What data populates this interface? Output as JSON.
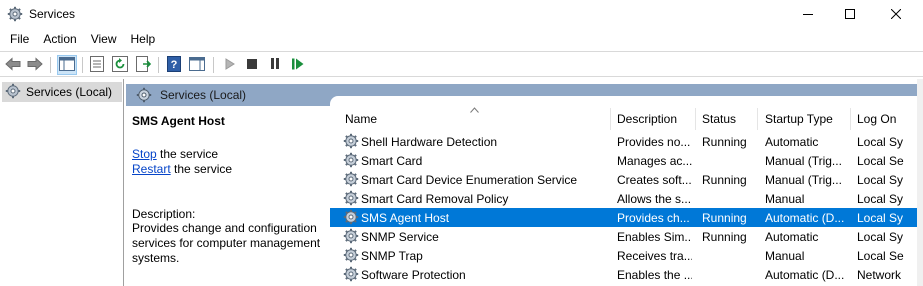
{
  "window": {
    "title": "Services",
    "controls": {
      "minimize": "minimize-icon",
      "maximize": "maximize-icon",
      "close": "close-icon"
    }
  },
  "menu": [
    "File",
    "Action",
    "View",
    "Help"
  ],
  "toolbar": {
    "icons": [
      "back-icon",
      "forward-icon",
      "console-tree-icon",
      "properties-icon",
      "refresh-icon",
      "export-list-icon",
      "help-icon",
      "show-hide-pane-icon",
      "start-service-icon",
      "stop-service-icon",
      "pause-service-icon",
      "restart-service-icon"
    ],
    "start_color": "#1a8f3c",
    "restart_color": "#1a8f3c"
  },
  "tree": {
    "root_label": "Services (Local)"
  },
  "pane": {
    "header_label": "Services (Local)"
  },
  "detail": {
    "service_name": "SMS Agent Host",
    "stop_link": "Stop",
    "stop_suffix": " the service",
    "restart_link": "Restart",
    "restart_suffix": " the service",
    "description_label": "Description:",
    "description": "Provides change and configuration services for computer management systems."
  },
  "columns": [
    "Name",
    "Description",
    "Status",
    "Startup Type",
    "Log On"
  ],
  "services": [
    {
      "name": "Shell Hardware Detection",
      "description": "Provides no...",
      "status": "Running",
      "startup": "Automatic",
      "logon": "Local Sy"
    },
    {
      "name": "Smart Card",
      "description": "Manages ac...",
      "status": "",
      "startup": "Manual (Trig...",
      "logon": "Local Se"
    },
    {
      "name": "Smart Card Device Enumeration Service",
      "description": "Creates soft...",
      "status": "Running",
      "startup": "Manual (Trig...",
      "logon": "Local Sy"
    },
    {
      "name": "Smart Card Removal Policy",
      "description": "Allows the s...",
      "status": "",
      "startup": "Manual",
      "logon": "Local Sy"
    },
    {
      "name": "SMS Agent Host",
      "description": "Provides ch...",
      "status": "Running",
      "startup": "Automatic (D...",
      "logon": "Local Sy"
    },
    {
      "name": "SNMP Service",
      "description": "Enables Sim...",
      "status": "Running",
      "startup": "Automatic",
      "logon": "Local Sy"
    },
    {
      "name": "SNMP Trap",
      "description": "Receives tra...",
      "status": "",
      "startup": "Manual",
      "logon": "Local Se"
    },
    {
      "name": "Software Protection",
      "description": "Enables the ...",
      "status": "",
      "startup": "Automatic (D...",
      "logon": "Network"
    }
  ],
  "selected_row": 4,
  "colors": {
    "selection": "#0078d7",
    "pane_header": "#8fa7c5",
    "link": "#0645c9"
  }
}
